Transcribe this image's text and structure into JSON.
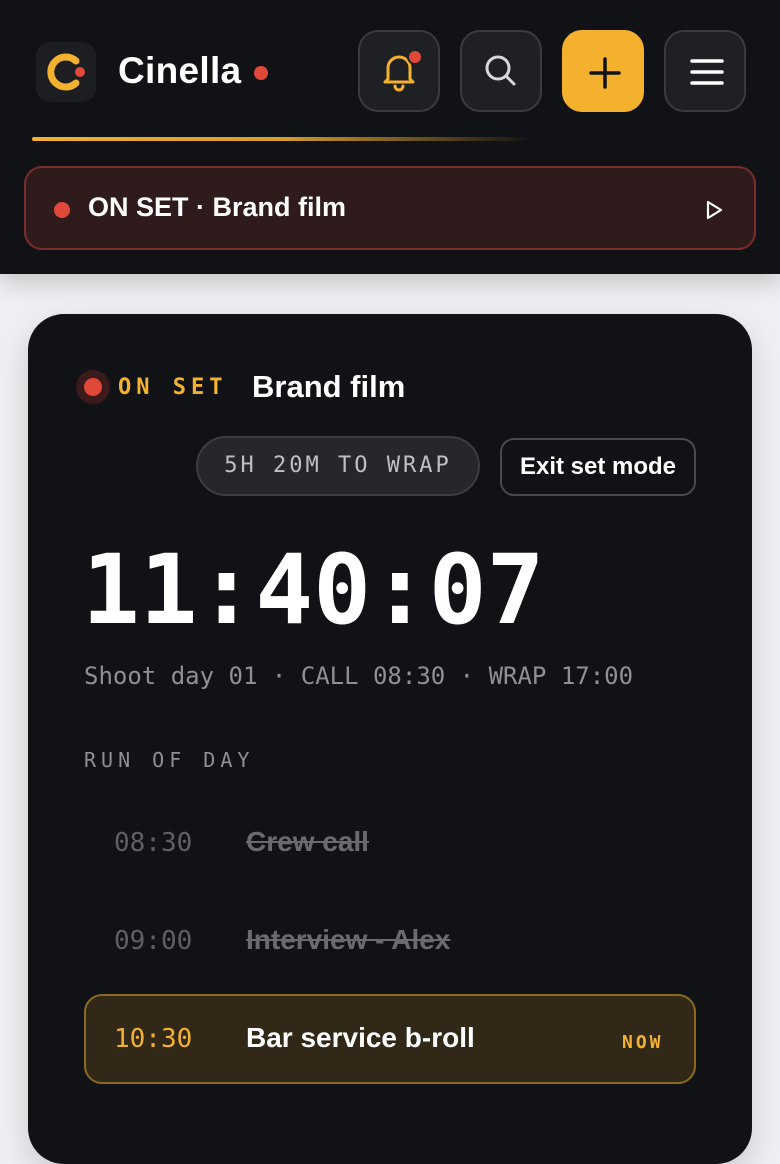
{
  "colors": {
    "accent": "#f3b12e",
    "recording": "#e0483a",
    "background_dark": "#111215",
    "page_background": "#eeeff2"
  },
  "header": {
    "app_name": "Cinella",
    "icons": [
      "cinella-logo-icon",
      "bell-icon",
      "search-icon",
      "plus-icon",
      "hamburger-menu-icon"
    ]
  },
  "banner": {
    "label": "ON SET · Brand film",
    "icon": "play-icon"
  },
  "set_card": {
    "status_label": "ON SET",
    "project_title": "Brand film",
    "wrap_countdown": "5H 20M TO WRAP",
    "exit_button": "Exit set mode",
    "clock": "11:40:07",
    "day_info": "Shoot day 01 · CALL 08:30 · WRAP 17:00",
    "run_of_day_label": "RUN OF DAY",
    "run_of_day": [
      {
        "time": "08:30",
        "name": "Crew call",
        "state": "done"
      },
      {
        "time": "09:00",
        "name": "Interview - Alex",
        "state": "done"
      },
      {
        "time": "10:30",
        "name": "Bar service b-roll",
        "state": "current",
        "badge": "NOW"
      }
    ]
  }
}
